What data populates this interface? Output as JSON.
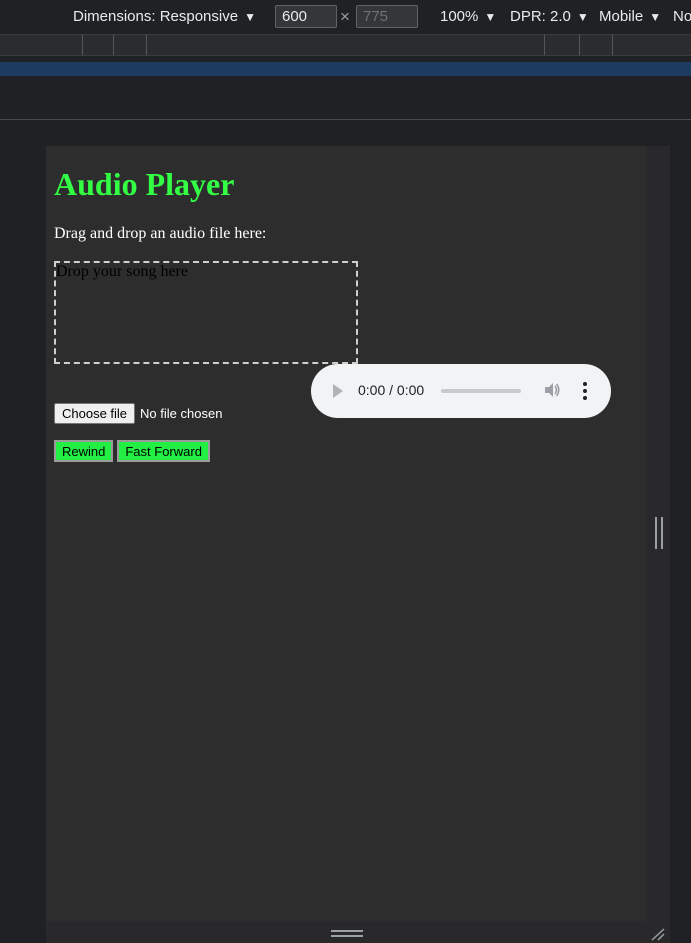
{
  "devtools": {
    "dimensions_label": "Dimensions: Responsive",
    "width_value": "600",
    "height_value": "775",
    "times_symbol": "×",
    "zoom_label": "100%",
    "dpr_label": "DPR: 2.0",
    "device_label": "Mobile",
    "throttle_label_partial": "No",
    "caret": "▼",
    "resize_corner_glyph": "⁄⁄"
  },
  "page": {
    "title": "Audio Player",
    "drag_prompt": "Drag and drop an audio file here:",
    "drop_zone_text": "Drop your song here",
    "audio": {
      "time_display": "0:00 / 0:00"
    },
    "file_input": {
      "button_label": "Choose file",
      "status": "No file chosen"
    },
    "buttons": {
      "rewind": "Rewind",
      "fast_forward": "Fast Forward"
    }
  },
  "colors": {
    "title_green": "#33ff44",
    "button_green": "#22ee44",
    "page_bg": "#2d2d2d",
    "devtools_bg": "#202124"
  }
}
